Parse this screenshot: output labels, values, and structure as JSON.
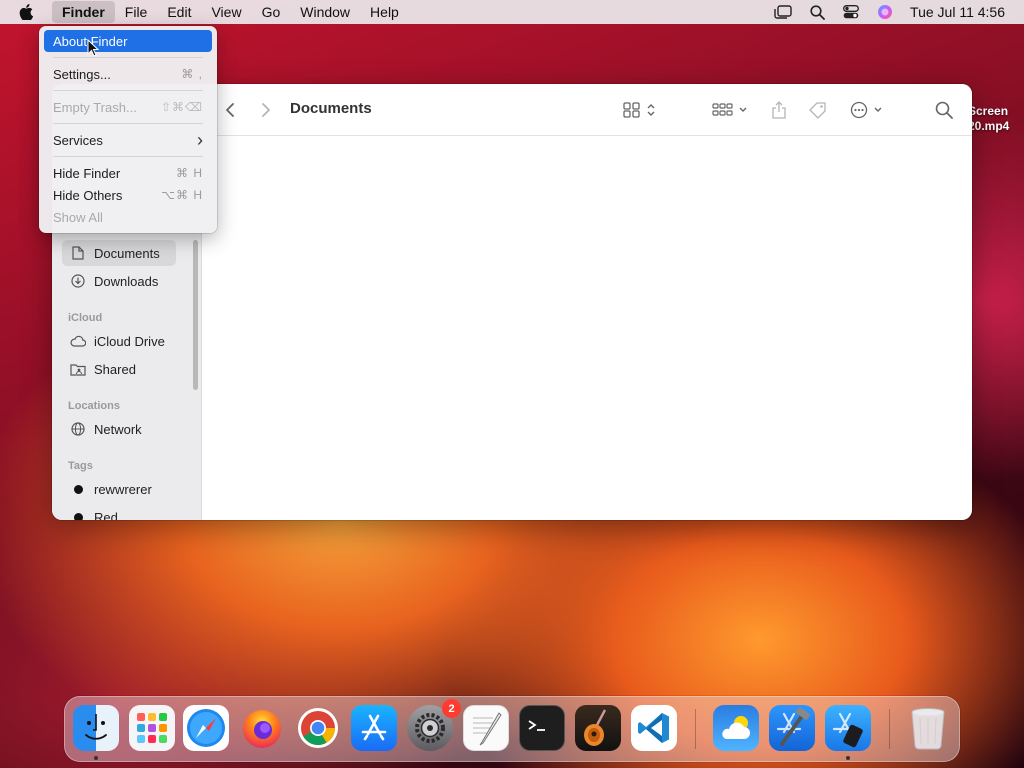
{
  "menubar": {
    "app_menus": [
      "Finder",
      "File",
      "Edit",
      "View",
      "Go",
      "Window",
      "Help"
    ],
    "status_icons": [
      "stage-manager-icon",
      "spotlight-search-icon",
      "control-center-icon",
      "siri-icon"
    ],
    "clock": "Tue Jul 11  4:56"
  },
  "finder_menu": {
    "items": {
      "about": {
        "label": "About Finder"
      },
      "settings": {
        "label": "Settings...",
        "shortcut": "⌘ ,"
      },
      "empty_trash": {
        "label": "Empty Trash...",
        "shortcut": "⇧⌘⌫"
      },
      "services": {
        "label": "Services",
        "submenu": "›"
      },
      "hide": {
        "label": "Hide Finder",
        "shortcut": "⌘ H"
      },
      "hide_others": {
        "label": "Hide Others",
        "shortcut": "⌥⌘ H"
      },
      "show_all": {
        "label": "Show All"
      }
    }
  },
  "window": {
    "title": "Documents",
    "sidebar": {
      "items": {
        "documents": "Documents",
        "downloads": "Downloads",
        "icloud_drive": "iCloud Drive",
        "shared": "Shared",
        "network": "Network",
        "tag1": "rewwrerer",
        "tag2": "Red"
      },
      "sections": {
        "icloud": "iCloud",
        "locations": "Locations",
        "tags": "Tags"
      }
    }
  },
  "desktop": {
    "file_label_line1": "Screen",
    "file_label_line2": "20.mp4"
  },
  "dock": {
    "apps": [
      "Finder",
      "Launchpad",
      "Safari",
      "Firefox",
      "Chrome",
      "App Store",
      "System Settings",
      "TextEdit",
      "Terminal",
      "GarageBand",
      "Visual Studio Code",
      "Weather",
      "Xcode",
      "Simulator",
      "Trash"
    ],
    "settings_badge": "2"
  }
}
